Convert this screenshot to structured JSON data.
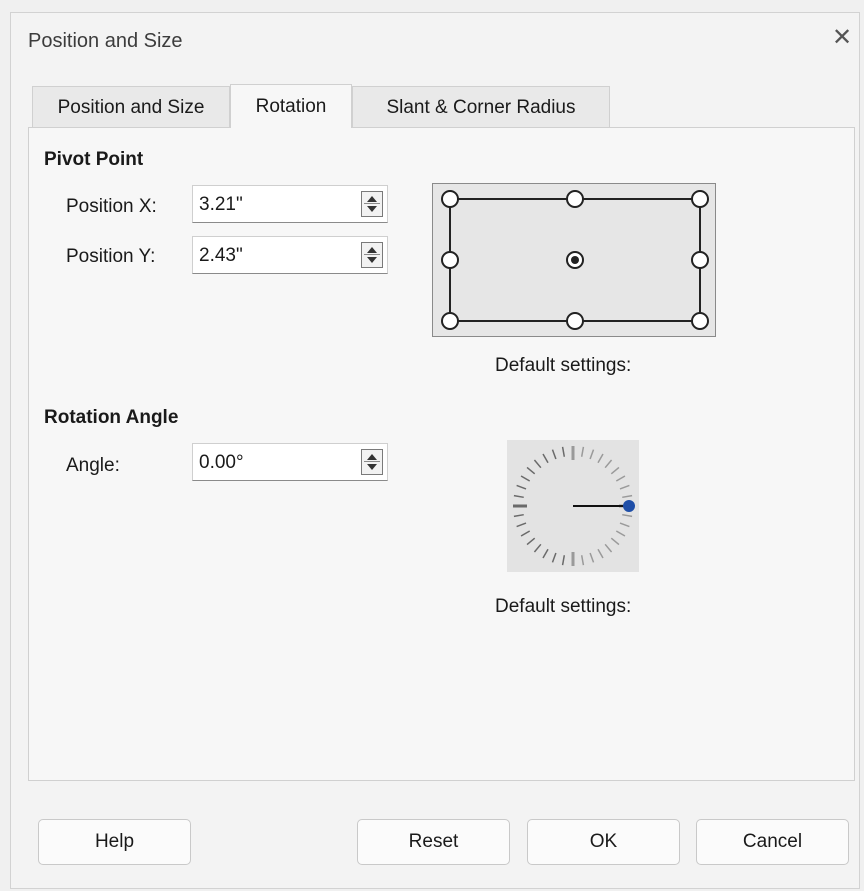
{
  "window": {
    "title": "Position and Size"
  },
  "tabs": [
    {
      "label": "Position and Size"
    },
    {
      "label": "Rotation",
      "active": true
    },
    {
      "label": "Slant & Corner Radius"
    }
  ],
  "pivot": {
    "heading": "Pivot Point",
    "x_label": "Position X:",
    "x_value": "3.21\"",
    "y_label": "Position Y:",
    "y_value": "2.43\"",
    "default_caption": "Default settings:",
    "selected_point": "center"
  },
  "rotation": {
    "heading": "Rotation Angle",
    "angle_label": "Angle:",
    "angle_value": "0.00°",
    "default_caption": "Default settings:",
    "dial_accent": "#1f4fa8"
  },
  "buttons": {
    "help": "Help",
    "reset": "Reset",
    "ok": "OK",
    "cancel": "Cancel"
  }
}
